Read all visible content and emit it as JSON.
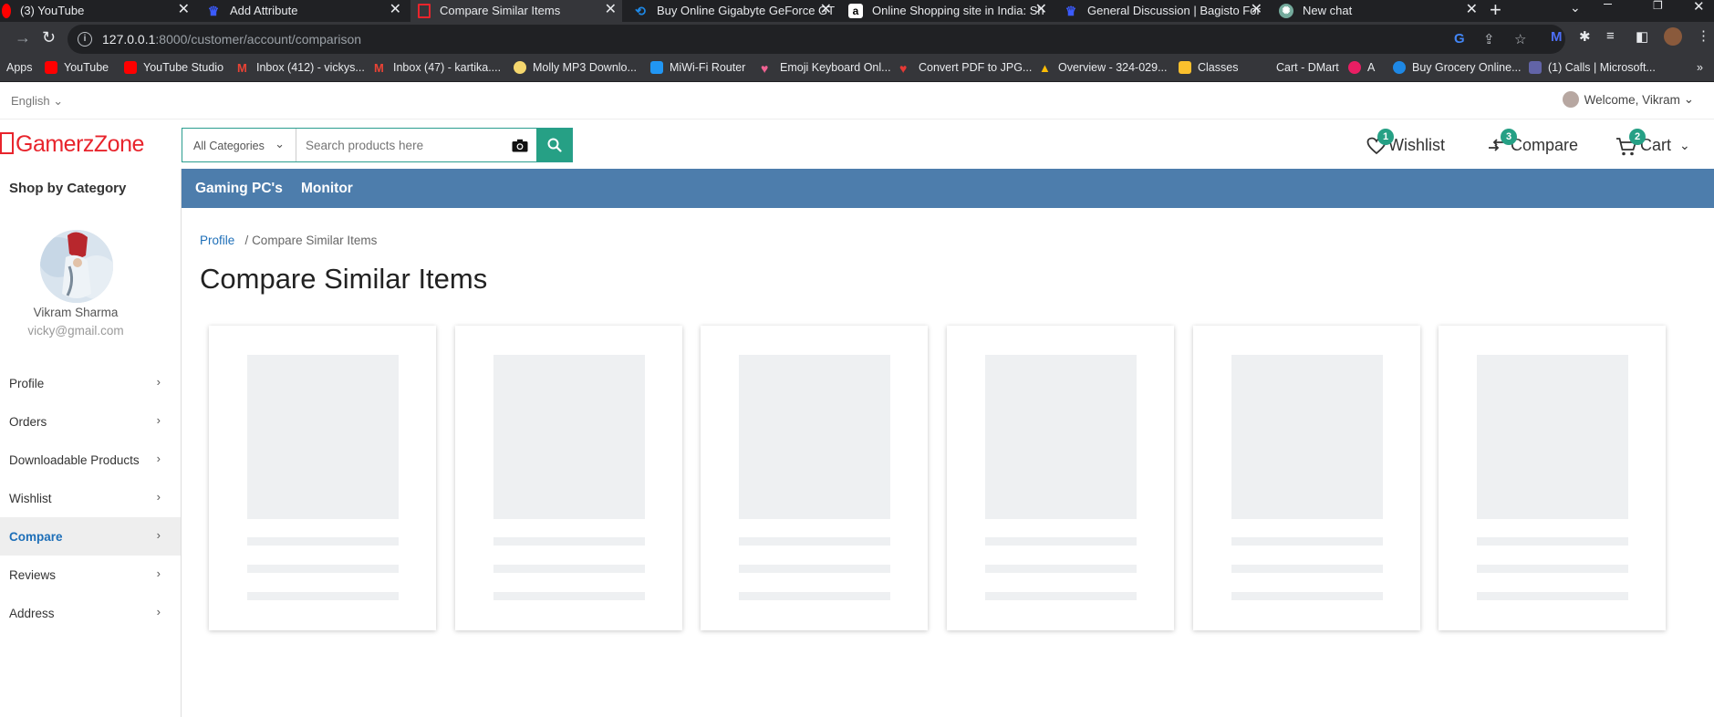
{
  "browser": {
    "tabs": [
      {
        "title": "(3) YouTube",
        "favicon": "youtube-icon",
        "color": "#ff0000"
      },
      {
        "title": "Add Attribute",
        "favicon": "bagisto-crown-icon",
        "color": "#1a3fc4"
      },
      {
        "title": "Compare Similar Items",
        "favicon": "gamerzone-icon",
        "color": "#e8242c"
      },
      {
        "title": "Buy Online Gigabyte GeForce GT",
        "favicon": "mdcomputers-icon",
        "color": "#1e88e5"
      },
      {
        "title": "Online Shopping site in India: Sh",
        "favicon": "amazon-icon",
        "color": "#ffffff"
      },
      {
        "title": "General Discussion | Bagisto For",
        "favicon": "bagisto-crown-icon",
        "color": "#1a3fc4"
      },
      {
        "title": "New chat",
        "favicon": "openai-icon",
        "color": "#74aa9c"
      }
    ],
    "url_host": "127.0.0.1",
    "url_path": ":8000/customer/account/comparison",
    "bookmarks": [
      {
        "label": "Apps",
        "icon": "apps-grid-icon",
        "color": "#35363a"
      },
      {
        "label": "YouTube",
        "icon": "youtube-icon",
        "color": "#ff0000"
      },
      {
        "label": "YouTube Studio",
        "icon": "youtube-studio-icon",
        "color": "#ff0000"
      },
      {
        "label": "Inbox (412) - vickys...",
        "icon": "gmail-icon",
        "color": "#ea4335"
      },
      {
        "label": "Inbox (47) - kartika....",
        "icon": "gmail-icon",
        "color": "#ea4335"
      },
      {
        "label": "Molly MP3 Downlo...",
        "icon": "molly-icon",
        "color": "#f5d76e"
      },
      {
        "label": "MiWi-Fi Router",
        "icon": "wifi-icon",
        "color": "#2196f3"
      },
      {
        "label": "Emoji Keyboard Onl...",
        "icon": "heart-icon",
        "color": "#f06292"
      },
      {
        "label": "Convert PDF to JPG...",
        "icon": "heart-icon",
        "color": "#e53935"
      },
      {
        "label": "Overview - 324-029...",
        "icon": "google-drive-icon",
        "color": "#fbbc05"
      },
      {
        "label": "Classes",
        "icon": "classroom-icon",
        "color": "#fbc02d"
      },
      {
        "label": "Cart - DMart",
        "icon": "dmart-icon",
        "color": "#35363a"
      },
      {
        "label": "A",
        "icon": "a-icon",
        "color": "#e91e63"
      },
      {
        "label": "Buy Grocery Online...",
        "icon": "grocery-icon",
        "color": "#1e88e5"
      },
      {
        "label": "(1) Calls | Microsoft...",
        "icon": "teams-icon",
        "color": "#6264a7"
      }
    ]
  },
  "topbar": {
    "language": "English",
    "welcome": "Welcome, Vikram"
  },
  "header": {
    "logo_text": "GamerzZone",
    "category_select": "All Categories",
    "search_placeholder": "Search products here",
    "wishlist_label": "Wishlist",
    "wishlist_count": "1",
    "compare_label": "Compare",
    "compare_count": "3",
    "cart_label": "Cart",
    "cart_count": "2",
    "accent": "#26a085"
  },
  "nav": {
    "shop_by_category": "Shop by Category",
    "items": [
      "Gaming PC's",
      "Monitor"
    ],
    "color": "#4d7dac"
  },
  "sidebar": {
    "user_name": "Vikram Sharma",
    "user_email": "vicky@gmail.com",
    "items": [
      {
        "label": "Profile"
      },
      {
        "label": "Orders"
      },
      {
        "label": "Downloadable Products"
      },
      {
        "label": "Wishlist"
      },
      {
        "label": "Compare"
      },
      {
        "label": "Reviews"
      },
      {
        "label": "Address"
      }
    ]
  },
  "main": {
    "breadcrumb_root": "Profile",
    "breadcrumb_sep": "/",
    "breadcrumb_current": "Compare Similar Items",
    "title": "Compare Similar Items"
  }
}
